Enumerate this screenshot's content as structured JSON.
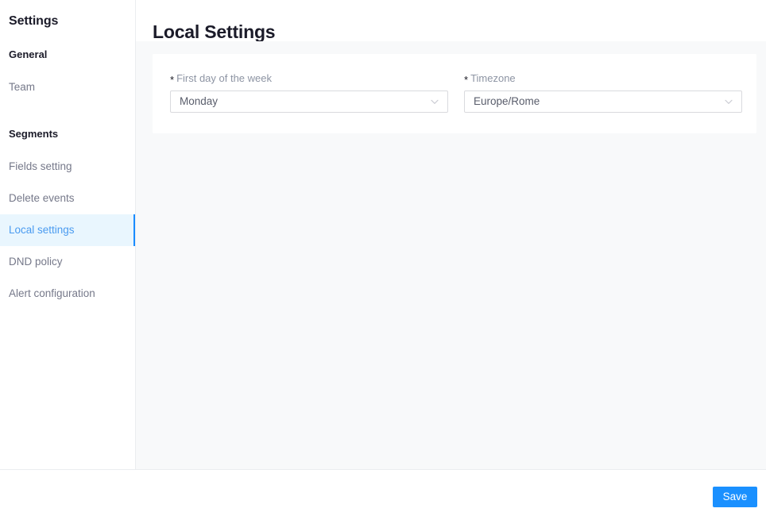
{
  "sidebar": {
    "title": "Settings",
    "groups": [
      {
        "label": "General",
        "items": [
          {
            "label": "Team",
            "active": false
          }
        ]
      },
      {
        "label": "Segments",
        "items": [
          {
            "label": "Fields setting",
            "active": false
          },
          {
            "label": "Delete events",
            "active": false
          },
          {
            "label": "Local settings",
            "active": true
          },
          {
            "label": "DND policy",
            "active": false
          },
          {
            "label": "Alert configuration",
            "active": false
          }
        ]
      }
    ]
  },
  "header": {
    "title": "Local Settings"
  },
  "form": {
    "required_mark": "*",
    "fields": [
      {
        "label": "First day of the week",
        "value": "Monday",
        "icon": "chevron-down-icon"
      },
      {
        "label": "Timezone",
        "value": "Europe/Rome",
        "icon": "chevron-down-icon"
      }
    ]
  },
  "footer": {
    "save_label": "Save"
  },
  "colors": {
    "accent": "#1a8cff",
    "primary_button": "#1a90ff",
    "active_item_bg": "#e9f6fe",
    "active_item_text": "#4a9bf0",
    "content_bg": "#f8f9fa",
    "text_primary": "#1b1b29",
    "text_muted": "#76798a",
    "border": "#ebedf0"
  }
}
